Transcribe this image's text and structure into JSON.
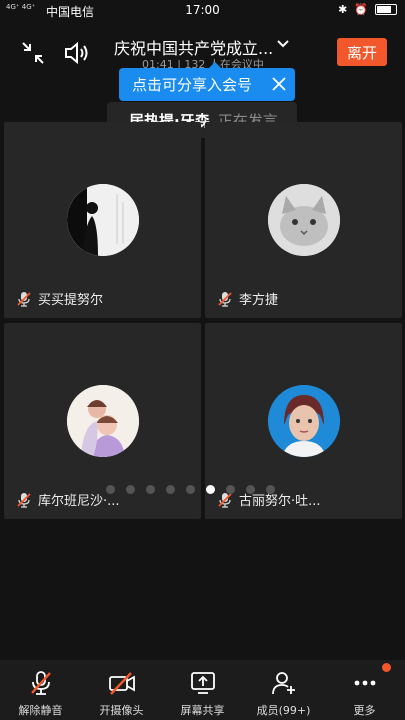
{
  "status_bar": {
    "signal": "4G⁺ 4G⁺",
    "carrier": "中国电信",
    "time": "17:00"
  },
  "meeting": {
    "title": "庆祝中国共产党成立...",
    "duration": "01:41",
    "participants_text": "132 人在会议中",
    "leave_label": "离开"
  },
  "share_tip": {
    "text": "点击可分享入会号"
  },
  "speaking": {
    "name": "居热提·牙森",
    "state": "正在发言"
  },
  "tiles": [
    {
      "name": "买买提努尔",
      "muted": true,
      "avatar": "silhouette-avatar"
    },
    {
      "name": "李方捷",
      "muted": true,
      "avatar": "cat-avatar"
    },
    {
      "name": "库尔班尼沙·...",
      "muted": true,
      "avatar": "girls-photo-avatar"
    },
    {
      "name": "古丽努尔·吐...",
      "muted": true,
      "avatar": "woman-photo-avatar"
    }
  ],
  "pagination": {
    "total": 9,
    "active_index": 5
  },
  "toolbar": [
    {
      "label": "解除静音",
      "icon": "mic-off-icon"
    },
    {
      "label": "开摄像头",
      "icon": "camera-off-icon"
    },
    {
      "label": "屏幕共享",
      "icon": "screen-share-icon"
    },
    {
      "label": "成员(99+)",
      "icon": "add-member-icon"
    },
    {
      "label": "更多",
      "icon": "more-icon"
    }
  ],
  "colors": {
    "accent_orange": "#f2582c",
    "tip_blue": "#1a8cf0",
    "mute_red": "#f2582c"
  }
}
